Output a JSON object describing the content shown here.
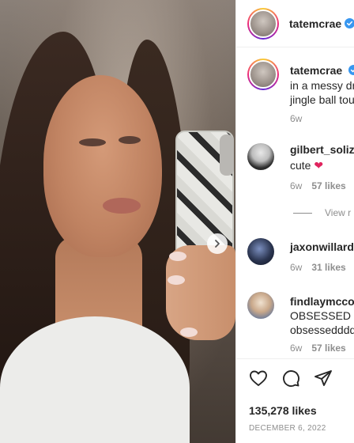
{
  "post": {
    "author": "tatemcrae",
    "caption_lines": [
      "in a messy dr",
      "jingle ball tou"
    ],
    "caption_time": "6w"
  },
  "comments": [
    {
      "user": "gilbert_soliz",
      "text": "cute",
      "time": "6w",
      "likes": "57 likes"
    },
    {
      "user": "jaxonwillard",
      "text": "",
      "time": "6w",
      "likes": "31 likes"
    },
    {
      "user": "findlaymccor",
      "text_lines": [
        "OBSESSED no",
        "obsesseddddc"
      ],
      "time": "6w",
      "likes": "57 likes"
    }
  ],
  "view_replies_label": "View r",
  "likes_count": "135,278 likes",
  "date": "DECEMBER 6, 2022",
  "icons": [
    "heart-icon",
    "comment-icon",
    "share-icon",
    "next-arrow-icon",
    "verified-icon"
  ],
  "colors": {
    "verified": "#3897f0",
    "heart": "#e0245e",
    "muted": "#8e8e8e"
  }
}
